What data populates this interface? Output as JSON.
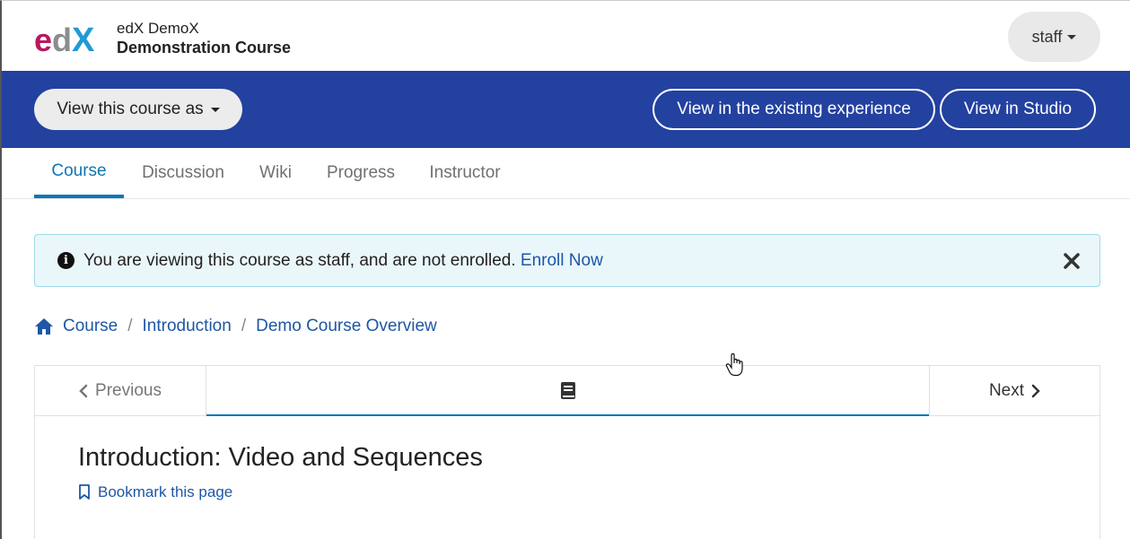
{
  "header": {
    "logo_text": "edX",
    "course_org": "edX DemoX",
    "course_title": "Demonstration Course",
    "user_label": "staff"
  },
  "bluebar": {
    "view_as_label": "View this course as",
    "existing_label": "View in the existing experience",
    "studio_label": "View in Studio"
  },
  "tabs": [
    {
      "label": "Course",
      "active": true
    },
    {
      "label": "Discussion",
      "active": false
    },
    {
      "label": "Wiki",
      "active": false
    },
    {
      "label": "Progress",
      "active": false
    },
    {
      "label": "Instructor",
      "active": false
    }
  ],
  "alert": {
    "message": "You are viewing this course as staff, and are not enrolled.",
    "link": "Enroll Now"
  },
  "breadcrumb": [
    "Course",
    "Introduction",
    "Demo Course Overview"
  ],
  "sequence": {
    "previous_label": "Previous",
    "next_label": "Next"
  },
  "unit": {
    "title": "Introduction: Video and Sequences",
    "bookmark_label": "Bookmark this page"
  },
  "colors": {
    "brand_blue": "#23419f",
    "link": "#1d57a5",
    "tab_active": "#0e75b4",
    "alert_bg": "#eaf7fa"
  }
}
